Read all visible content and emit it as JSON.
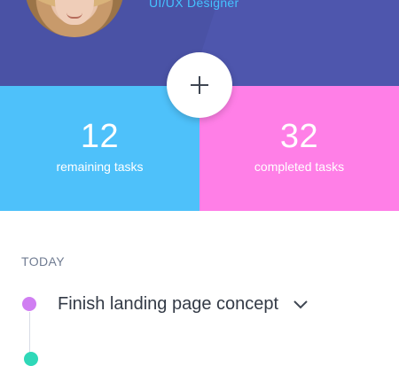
{
  "profile": {
    "role": "UI/UX Designer"
  },
  "stats": {
    "remaining": {
      "count": "12",
      "label": "remaining tasks"
    },
    "completed": {
      "count": "32",
      "label": "completed tasks"
    }
  },
  "icons": {
    "add": "plus-icon",
    "expand": "chevron-down-icon"
  },
  "colors": {
    "header": "#4a52a5",
    "remaining": "#4ec1fa",
    "completed": "#ff7fe7",
    "accent_role": "#45c2ff",
    "timeline_dot_1": "#d07ef2",
    "timeline_dot_2": "#2fd8b8"
  },
  "today": {
    "section_title": "TODAY",
    "tasks": [
      {
        "title": "Finish landing page concept"
      }
    ]
  }
}
